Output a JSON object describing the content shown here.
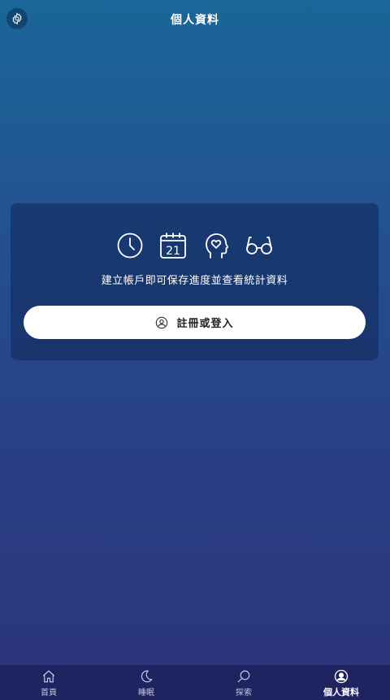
{
  "header": {
    "title": "個人資料",
    "settings_icon": "gear-icon"
  },
  "card": {
    "icons": [
      "clock-icon",
      "calendar-icon",
      "head-heart-icon",
      "glasses-icon"
    ],
    "calendar_day": "21",
    "message": "建立帳戶即可保存進度並查看統計資料",
    "signup_icon": "user-icon",
    "signup_label": "註冊或登入"
  },
  "tabbar": {
    "items": [
      {
        "label": "首頁",
        "icon": "home-icon",
        "active": false
      },
      {
        "label": "睡眠",
        "icon": "moon-icon",
        "active": false
      },
      {
        "label": "探索",
        "icon": "search-icon",
        "active": false
      },
      {
        "label": "個人資料",
        "icon": "profile-icon",
        "active": true
      }
    ]
  },
  "colors": {
    "gradient_top": "#1a6699",
    "gradient_bottom": "#2c3479",
    "tabbar_bg": "#1f2360",
    "button_bg": "#ffffff"
  }
}
